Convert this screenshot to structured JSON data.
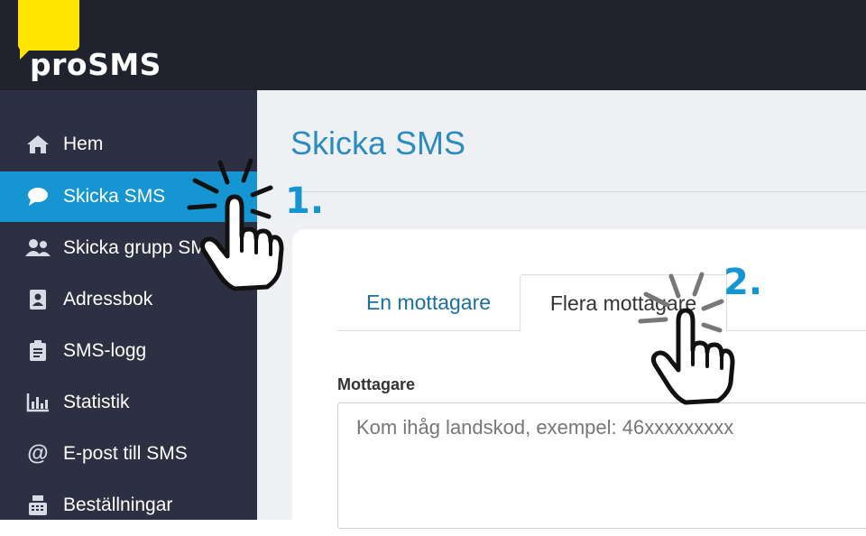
{
  "brand": {
    "name": "proSMS",
    "logo_color": "#ffe500"
  },
  "colors": {
    "topbar": "#20222e",
    "sidebar": "#2d3042",
    "accent": "#1596d3",
    "title": "#2d8cbf"
  },
  "sidebar": {
    "items": [
      {
        "label": "Hem",
        "icon": "home-icon",
        "active": false
      },
      {
        "label": "Skicka SMS",
        "icon": "chat-bubble-icon",
        "active": true
      },
      {
        "label": "Skicka grupp SMS",
        "icon": "users-icon",
        "active": false
      },
      {
        "label": "Adressbok",
        "icon": "address-book-icon",
        "active": false
      },
      {
        "label": "SMS-logg",
        "icon": "clipboard-icon",
        "active": false
      },
      {
        "label": "Statistik",
        "icon": "bar-chart-icon",
        "active": false
      },
      {
        "label": "E-post till SMS",
        "icon": "at-sign-icon",
        "active": false
      },
      {
        "label": "Beställningar",
        "icon": "cash-register-icon",
        "active": false
      }
    ]
  },
  "main": {
    "title": "Skicka SMS",
    "tabs": [
      {
        "label": "En mottagare",
        "active": false
      },
      {
        "label": "Flera mottagare",
        "active": true
      }
    ],
    "recipient": {
      "label": "Mottagare",
      "placeholder": "Kom ihåg landskod, exempel: 46xxxxxxxxx",
      "value": ""
    }
  },
  "annotations": {
    "step1": "1.",
    "step2": "2."
  }
}
